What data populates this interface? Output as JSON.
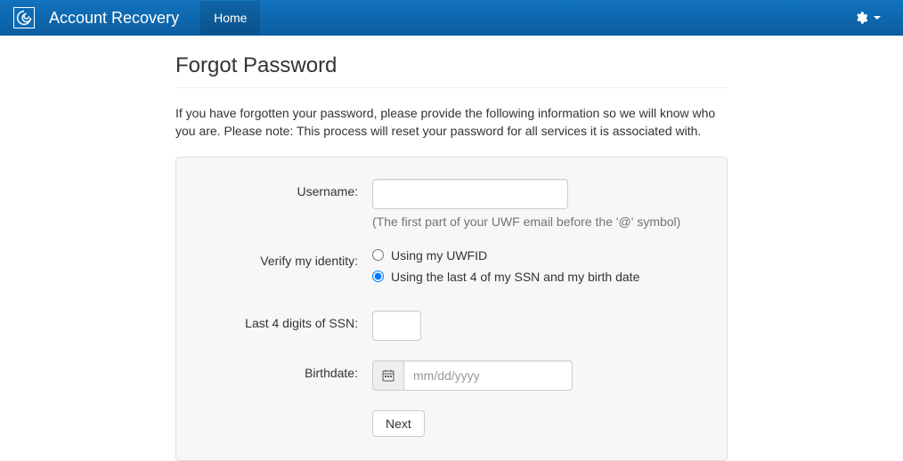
{
  "navbar": {
    "brand": "Account Recovery",
    "home_label": "Home"
  },
  "page": {
    "title": "Forgot Password",
    "intro": "If you have forgotten your password, please provide the following information so we will know who you are. Please note: This process will reset your password for all services it is associated with."
  },
  "form": {
    "username_label": "Username:",
    "username_value": "",
    "username_help": "(The first part of your UWF email before the '@' symbol)",
    "verify_label": "Verify my identity:",
    "verify_options": {
      "uwfid": "Using my UWFID",
      "ssn": "Using the last 4 of my SSN and my birth date"
    },
    "verify_selected": "ssn",
    "ssn_label": "Last 4 digits of SSN:",
    "ssn_value": "",
    "birthdate_label": "Birthdate:",
    "birthdate_placeholder": "mm/dd/yyyy",
    "birthdate_value": "",
    "next_label": "Next"
  }
}
